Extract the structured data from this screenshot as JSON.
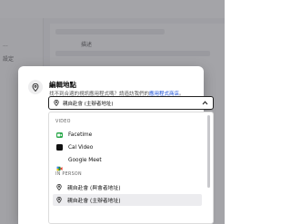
{
  "background": {
    "frag1": "...",
    "frag2": "設定",
    "frag3": "描述"
  },
  "modal": {
    "title": "編輯地點",
    "subtitle_text": "找不到合適的視訊應用程式嗎？請造訪我們的",
    "subtitle_link": "應用程式商店",
    "subtitle_end": "。"
  },
  "select": {
    "value": "親自赴會 (主辦者地址)"
  },
  "dropdown": {
    "groups": [
      {
        "label": "VIDEO",
        "options": [
          {
            "label": "Facetime",
            "icon": "facetime-icon"
          },
          {
            "label": "Cal Video",
            "icon": "cal-video-icon"
          },
          {
            "label": "Google Meet",
            "icon": "google-meet-icon"
          }
        ]
      },
      {
        "label": "IN PERSON",
        "options": [
          {
            "label": "親自赴會 (與會者地址)",
            "icon": "map-pin-icon"
          },
          {
            "label": "親自赴會 (主辦者地址)",
            "icon": "map-pin-icon",
            "highlighted": true
          }
        ]
      }
    ]
  },
  "colors": {
    "link": "#1a4fd6",
    "overlay": "rgba(90,90,96,0.55)",
    "facetime": "#2aa84a"
  }
}
